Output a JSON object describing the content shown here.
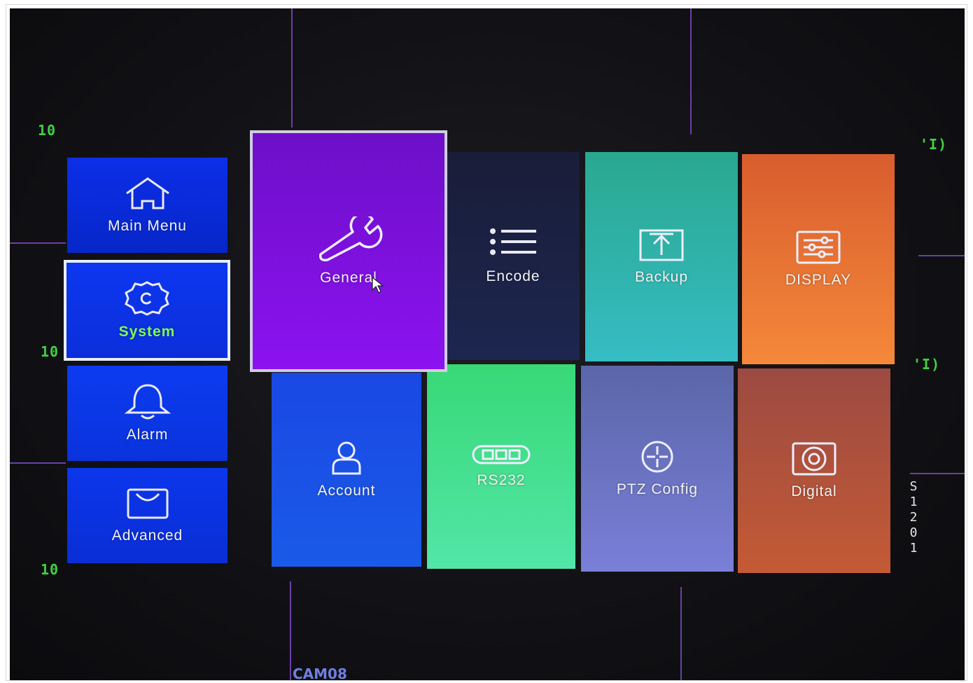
{
  "sidebar": {
    "items": [
      {
        "label": "Main Menu",
        "icon": "home-icon",
        "color": "#0a2ee0",
        "selected": false
      },
      {
        "label": "System",
        "icon": "gear-icon",
        "color": "#0a33ea",
        "selected": true,
        "label_color": "#7dfc5a"
      },
      {
        "label": "Alarm",
        "icon": "bell-icon",
        "color": "#0b37e8",
        "selected": false
      },
      {
        "label": "Advanced",
        "icon": "bag-icon",
        "color": "#0a34e6",
        "selected": false
      }
    ]
  },
  "tiles": {
    "general": {
      "label": "General",
      "icon": "wrench-icon",
      "color": "#8a0fe0"
    },
    "encode": {
      "label": "Encode",
      "icon": "list-icon",
      "color": "#1a2247"
    },
    "backup": {
      "label": "Backup",
      "icon": "upload-icon",
      "color": "#2fb3a3"
    },
    "display": {
      "label": "DISPLAY",
      "icon": "sliders-icon",
      "color": "#ef7a30"
    },
    "account": {
      "label": "Account",
      "icon": "user-icon",
      "color": "#1a4fe6"
    },
    "rs232": {
      "label": "RS232",
      "icon": "serial-port-icon",
      "color": "#45de8a"
    },
    "ptz": {
      "label": "PTZ Config",
      "icon": "crosshair-icon",
      "color": "#6f74c9"
    },
    "digital": {
      "label": "Digital",
      "icon": "disk-icon",
      "color": "#b5553c"
    }
  },
  "osd": {
    "cam_label": "CAM08",
    "top_left": "10",
    "mid_left": "10",
    "bottom_left": "10",
    "right_mid": "'I)",
    "right_top": "'I)",
    "vertical": [
      "S",
      "1",
      "2",
      "0",
      "1"
    ]
  }
}
